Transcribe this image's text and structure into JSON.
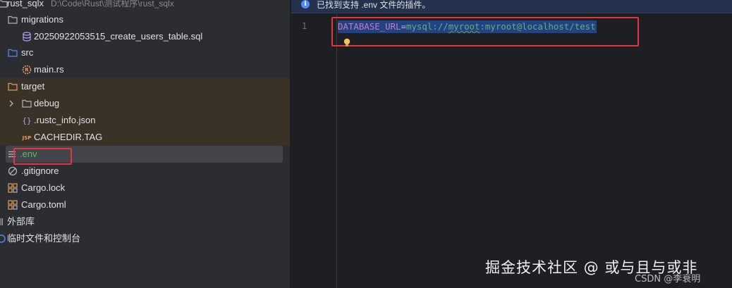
{
  "banner": {
    "text": "已找到支持 .env 文件的插件。",
    "icon": "info-icon"
  },
  "tree": {
    "root": {
      "label": "rust_sqlx",
      "path": "D:\\Code\\Rust\\测试程序\\rust_sqlx"
    },
    "items": [
      {
        "label": "migrations",
        "icon": "folder-icon"
      },
      {
        "label": "20250922053515_create_users_table.sql",
        "icon": "database-file-icon"
      },
      {
        "label": "src",
        "icon": "folder-icon"
      },
      {
        "label": "main.rs",
        "icon": "rust-file-icon"
      },
      {
        "label": "target",
        "icon": "folder-excluded-icon"
      },
      {
        "label": "debug",
        "icon": "folder-icon"
      },
      {
        "label": ".rustc_info.json",
        "icon": "json-file-icon"
      },
      {
        "label": "CACHEDIR.TAG",
        "icon": "jsp-file-icon"
      },
      {
        "label": ".env",
        "icon": "text-file-icon"
      },
      {
        "label": ".gitignore",
        "icon": "ignore-file-icon"
      },
      {
        "label": "Cargo.lock",
        "icon": "cargo-file-icon"
      },
      {
        "label": "Cargo.toml",
        "icon": "cargo-file-icon"
      },
      {
        "label": "外部库",
        "icon": "library-icon"
      },
      {
        "label": "临时文件和控制台",
        "icon": "scratch-icon"
      }
    ]
  },
  "editor": {
    "line_number": "1",
    "code": {
      "key": "DATABASE_URL",
      "eq": "=",
      "val_prefix": "mysql://",
      "val_user": "myroot",
      "val_rest": ":myroot@localhost/test"
    }
  },
  "watermark": {
    "main": "掘金技术社区 @ 或与且与或非",
    "sub": "CSDN @李衰明"
  },
  "colors": {
    "accent_blue": "#548af7",
    "selection": "#214283",
    "highlight_red": "#e0383e",
    "excluded_bg": "#3a3226",
    "folder_line": "#aeb3c2",
    "env_label": "#5fb865"
  }
}
